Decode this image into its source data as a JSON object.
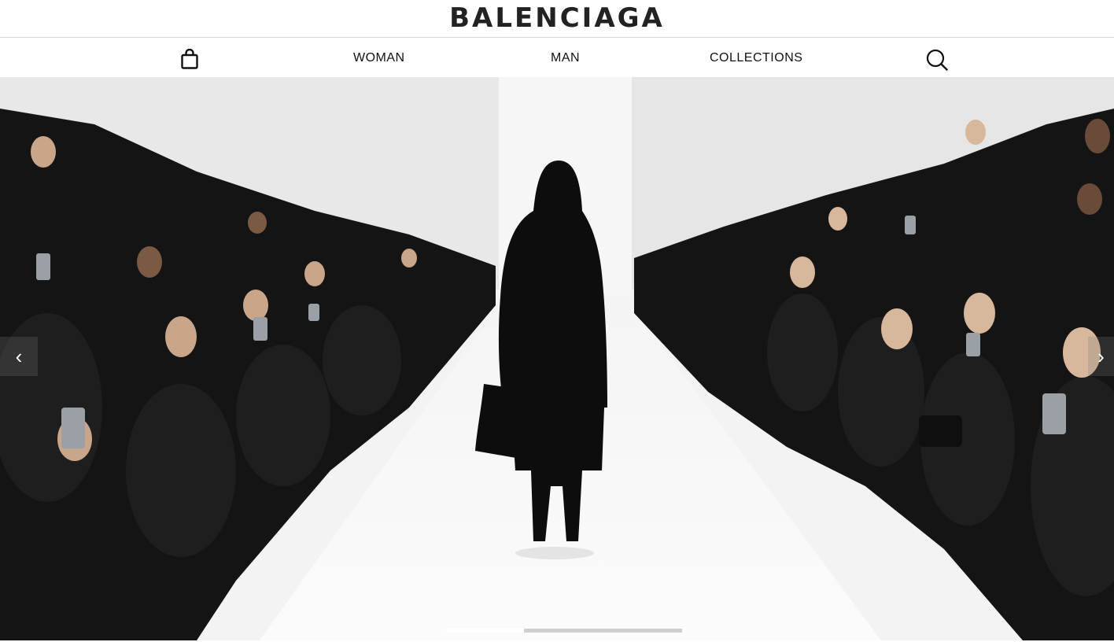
{
  "header": {
    "logo": "BALENCIAGA"
  },
  "nav": {
    "items": [
      "WOMAN",
      "MAN",
      "COLLECTIONS"
    ],
    "bag_icon": "shopping-bag-icon",
    "search_icon": "search-icon"
  },
  "hero": {
    "prev_arrow": "‹",
    "next_arrow": "›",
    "slide_progress": 0.33
  },
  "colors": {
    "background": "#ffffff",
    "text": "#111111"
  }
}
